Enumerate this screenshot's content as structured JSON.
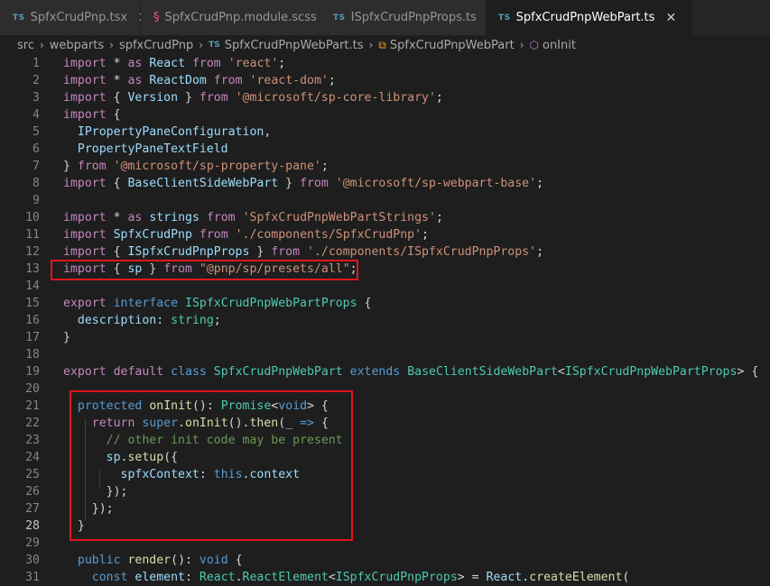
{
  "tabs": [
    {
      "icon": "TS",
      "label": "SpfxCrudPnp.tsx",
      "close": "✕",
      "active": false
    },
    {
      "icon": "scss-icon",
      "label": "SpfxCrudPnp.module.scss",
      "active": false
    },
    {
      "icon": "TS",
      "label": "ISpfxCrudPnpProps.ts",
      "active": false
    },
    {
      "icon": "TS",
      "label": "SpfxCrudPnpWebPart.ts",
      "close": "✕",
      "active": true
    }
  ],
  "breadcrumb": {
    "items": [
      "src",
      "webparts",
      "spfxCrudPnp"
    ],
    "file": "SpfxCrudPnpWebPart.ts",
    "file_icon": "TS",
    "class_name": "SpfxCrudPnpWebPart",
    "method": "onInit",
    "separator": "›"
  },
  "editor": {
    "current_line": 28,
    "lines": [
      {
        "n": "1",
        "t": [
          [
            "import",
            "c"
          ],
          [
            " * ",
            "p"
          ],
          [
            "as",
            "c"
          ],
          [
            " ",
            "p"
          ],
          [
            "React",
            "v"
          ],
          [
            " ",
            "p"
          ],
          [
            "from",
            "c"
          ],
          [
            " ",
            "p"
          ],
          [
            "'react'",
            "s"
          ],
          [
            ";",
            "p"
          ]
        ]
      },
      {
        "n": "2",
        "t": [
          [
            "import",
            "c"
          ],
          [
            " * ",
            "p"
          ],
          [
            "as",
            "c"
          ],
          [
            " ",
            "p"
          ],
          [
            "ReactDom",
            "v"
          ],
          [
            " ",
            "p"
          ],
          [
            "from",
            "c"
          ],
          [
            " ",
            "p"
          ],
          [
            "'react-dom'",
            "s"
          ],
          [
            ";",
            "p"
          ]
        ]
      },
      {
        "n": "3",
        "t": [
          [
            "import",
            "c"
          ],
          [
            " { ",
            "p"
          ],
          [
            "Version",
            "v"
          ],
          [
            " } ",
            "p"
          ],
          [
            "from",
            "c"
          ],
          [
            " ",
            "p"
          ],
          [
            "'@microsoft/sp-core-library'",
            "s"
          ],
          [
            ";",
            "p"
          ]
        ]
      },
      {
        "n": "4",
        "t": [
          [
            "import",
            "c"
          ],
          [
            " {",
            "p"
          ]
        ]
      },
      {
        "n": "5",
        "t": [
          [
            "  ",
            "p"
          ],
          [
            "IPropertyPaneConfiguration",
            "v"
          ],
          [
            ",",
            "p"
          ]
        ]
      },
      {
        "n": "6",
        "t": [
          [
            "  ",
            "p"
          ],
          [
            "PropertyPaneTextField",
            "v"
          ]
        ]
      },
      {
        "n": "7",
        "t": [
          [
            "} ",
            "p"
          ],
          [
            "from",
            "c"
          ],
          [
            " ",
            "p"
          ],
          [
            "'@microsoft/sp-property-pane'",
            "s"
          ],
          [
            ";",
            "p"
          ]
        ]
      },
      {
        "n": "8",
        "t": [
          [
            "import",
            "c"
          ],
          [
            " { ",
            "p"
          ],
          [
            "BaseClientSideWebPart",
            "v"
          ],
          [
            " } ",
            "p"
          ],
          [
            "from",
            "c"
          ],
          [
            " ",
            "p"
          ],
          [
            "'@microsoft/sp-webpart-base'",
            "s"
          ],
          [
            ";",
            "p"
          ]
        ]
      },
      {
        "n": "9",
        "t": []
      },
      {
        "n": "10",
        "t": [
          [
            "import",
            "c"
          ],
          [
            " * ",
            "p"
          ],
          [
            "as",
            "c"
          ],
          [
            " ",
            "p"
          ],
          [
            "strings",
            "v"
          ],
          [
            " ",
            "p"
          ],
          [
            "from",
            "c"
          ],
          [
            " ",
            "p"
          ],
          [
            "'SpfxCrudPnpWebPartStrings'",
            "s"
          ],
          [
            ";",
            "p"
          ]
        ]
      },
      {
        "n": "11",
        "t": [
          [
            "import",
            "c"
          ],
          [
            " ",
            "p"
          ],
          [
            "SpfxCrudPnp",
            "v"
          ],
          [
            " ",
            "p"
          ],
          [
            "from",
            "c"
          ],
          [
            " ",
            "p"
          ],
          [
            "'./components/SpfxCrudPnp'",
            "s"
          ],
          [
            ";",
            "p"
          ]
        ]
      },
      {
        "n": "12",
        "t": [
          [
            "import",
            "c"
          ],
          [
            " { ",
            "p"
          ],
          [
            "ISpfxCrudPnpProps",
            "v"
          ],
          [
            " } ",
            "p"
          ],
          [
            "from",
            "c"
          ],
          [
            " ",
            "p"
          ],
          [
            "'./components/ISpfxCrudPnpProps'",
            "s"
          ],
          [
            ";",
            "p"
          ]
        ]
      },
      {
        "n": "13",
        "t": [
          [
            "import",
            "c"
          ],
          [
            " { ",
            "p"
          ],
          [
            "sp",
            "v"
          ],
          [
            " } ",
            "p"
          ],
          [
            "from",
            "c"
          ],
          [
            " ",
            "p"
          ],
          [
            "\"@pnp/sp/presets/all\"",
            "s"
          ],
          [
            ";",
            "p"
          ]
        ]
      },
      {
        "n": "14",
        "t": []
      },
      {
        "n": "15",
        "t": [
          [
            "export",
            "c"
          ],
          [
            " ",
            "p"
          ],
          [
            "interface",
            "k"
          ],
          [
            " ",
            "p"
          ],
          [
            "ISpfxCrudPnpWebPartProps",
            "t"
          ],
          [
            " {",
            "p"
          ]
        ]
      },
      {
        "n": "16",
        "t": [
          [
            "  ",
            "p"
          ],
          [
            "description",
            "v"
          ],
          [
            ": ",
            "p"
          ],
          [
            "string",
            "t"
          ],
          [
            ";",
            "p"
          ]
        ]
      },
      {
        "n": "17",
        "t": [
          [
            "}",
            "p"
          ]
        ]
      },
      {
        "n": "18",
        "t": []
      },
      {
        "n": "19",
        "t": [
          [
            "export",
            "c"
          ],
          [
            " ",
            "p"
          ],
          [
            "default",
            "c"
          ],
          [
            " ",
            "p"
          ],
          [
            "class",
            "k"
          ],
          [
            " ",
            "p"
          ],
          [
            "SpfxCrudPnpWebPart",
            "t"
          ],
          [
            " ",
            "p"
          ],
          [
            "extends",
            "k"
          ],
          [
            " ",
            "p"
          ],
          [
            "BaseClientSideWebPart",
            "t"
          ],
          [
            "<",
            "p"
          ],
          [
            "ISpfxCrudPnpWebPartProps",
            "t"
          ],
          [
            "> {",
            "p"
          ]
        ]
      },
      {
        "n": "20",
        "t": []
      },
      {
        "n": "21",
        "t": [
          [
            "  ",
            "p"
          ],
          [
            "protected",
            "k"
          ],
          [
            " ",
            "p"
          ],
          [
            "onInit",
            "f"
          ],
          [
            "(): ",
            "p"
          ],
          [
            "Promise",
            "t"
          ],
          [
            "<",
            "p"
          ],
          [
            "void",
            "k"
          ],
          [
            "> {",
            "p"
          ]
        ]
      },
      {
        "n": "22",
        "t": [
          [
            "    ",
            "p"
          ],
          [
            "return",
            "c"
          ],
          [
            " ",
            "p"
          ],
          [
            "super",
            "k"
          ],
          [
            ".",
            "p"
          ],
          [
            "onInit",
            "f"
          ],
          [
            "().",
            "p"
          ],
          [
            "then",
            "f"
          ],
          [
            "(",
            "p"
          ],
          [
            "_",
            "v"
          ],
          [
            " ",
            "p"
          ],
          [
            "=>",
            "k"
          ],
          [
            " {",
            "p"
          ]
        ]
      },
      {
        "n": "23",
        "t": [
          [
            "      ",
            "p"
          ],
          [
            "// other init code may be present",
            "cm"
          ]
        ]
      },
      {
        "n": "24",
        "t": [
          [
            "      ",
            "p"
          ],
          [
            "sp",
            "v"
          ],
          [
            ".",
            "p"
          ],
          [
            "setup",
            "f"
          ],
          [
            "({",
            "p"
          ]
        ]
      },
      {
        "n": "25",
        "t": [
          [
            "        ",
            "p"
          ],
          [
            "spfxContext",
            "v"
          ],
          [
            ": ",
            "p"
          ],
          [
            "this",
            "k"
          ],
          [
            ".",
            "p"
          ],
          [
            "context",
            "v"
          ]
        ]
      },
      {
        "n": "26",
        "t": [
          [
            "      ",
            "p"
          ],
          [
            "});",
            "p"
          ]
        ]
      },
      {
        "n": "27",
        "t": [
          [
            "    ",
            "p"
          ],
          [
            "});",
            "p"
          ]
        ]
      },
      {
        "n": "28",
        "t": [
          [
            "  ",
            "p"
          ],
          [
            "}",
            "p"
          ]
        ]
      },
      {
        "n": "29",
        "t": []
      },
      {
        "n": "30",
        "t": [
          [
            "  ",
            "p"
          ],
          [
            "public",
            "k"
          ],
          [
            " ",
            "p"
          ],
          [
            "render",
            "f"
          ],
          [
            "(): ",
            "p"
          ],
          [
            "void",
            "k"
          ],
          [
            " {",
            "p"
          ]
        ]
      },
      {
        "n": "31",
        "t": [
          [
            "    ",
            "p"
          ],
          [
            "const",
            "k"
          ],
          [
            " ",
            "p"
          ],
          [
            "element",
            "v"
          ],
          [
            ": ",
            "p"
          ],
          [
            "React",
            "t"
          ],
          [
            ".",
            "p"
          ],
          [
            "ReactElement",
            "t"
          ],
          [
            "<",
            "p"
          ],
          [
            "ISpfxCrudPnpProps",
            "t"
          ],
          [
            "> = ",
            "p"
          ],
          [
            "React",
            "v"
          ],
          [
            ".",
            "p"
          ],
          [
            "createElement",
            "f"
          ],
          [
            "(",
            "p"
          ]
        ]
      }
    ]
  },
  "highlight_color": "#e0161c"
}
